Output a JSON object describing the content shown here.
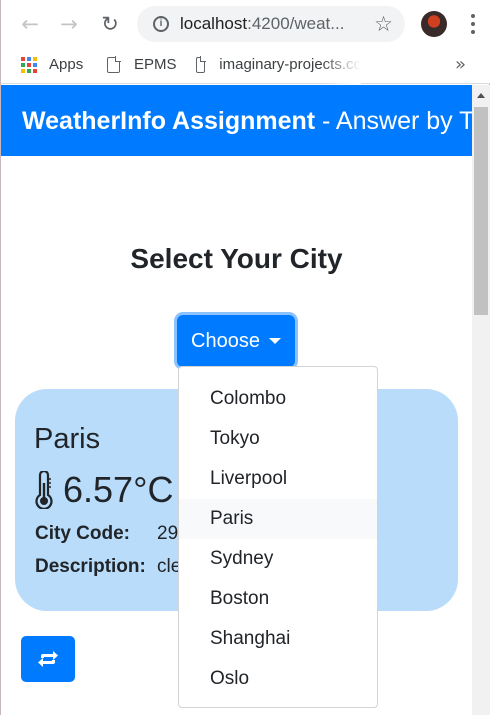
{
  "browser": {
    "url_host": "localhost",
    "url_rest": ":4200/weat...",
    "back_icon": "←",
    "forward_icon": "→",
    "reload_icon": "↻",
    "star_icon": "☆",
    "info_icon": "i",
    "bookmarks": [
      {
        "label": "Apps",
        "icon": "apps-icon"
      },
      {
        "label": "EPMS",
        "icon": "document-icon"
      },
      {
        "label": "imaginary-projects.cc",
        "icon": "document-icon"
      }
    ],
    "overflow_icon": "»"
  },
  "header": {
    "title_bold": "WeatherInfo Assignment",
    "title_rest": " - Answer by T"
  },
  "main": {
    "heading": "Select Your City",
    "choose_label": "Choose"
  },
  "card": {
    "city": "Paris",
    "temperature": "6.57°C",
    "city_code_label": "City Code:",
    "city_code_value": "29",
    "description_label": "Description:",
    "description_value": "cle"
  },
  "dropdown": {
    "items": [
      "Colombo",
      "Tokyo",
      "Liverpool",
      "Paris",
      "Sydney",
      "Boston",
      "Shanghai",
      "Oslo"
    ],
    "highlighted": "Paris"
  },
  "colors": {
    "primary": "#007bff",
    "card_bg": "#b8dcf9"
  }
}
